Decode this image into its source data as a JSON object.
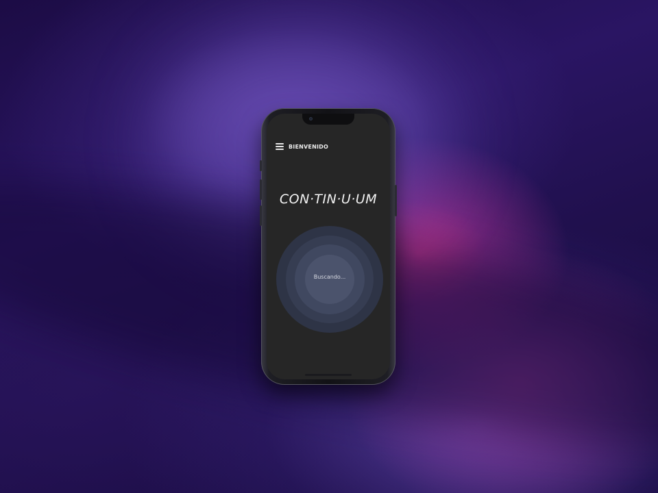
{
  "app_bar": {
    "title": "BIENVENIDO",
    "menu_icon": "hamburger-menu-icon"
  },
  "brand": {
    "name": "CON·TIN·U·UM"
  },
  "search": {
    "status": "Buscando...",
    "animation_icon": "radar-pulse-icon"
  },
  "colors": {
    "screen_background": "#262626",
    "ring_outer": "#2e3446",
    "ring_inner": "#4b536c",
    "wallpaper_accent": "#d63a96",
    "wallpaper_base": "#1c0c45"
  }
}
